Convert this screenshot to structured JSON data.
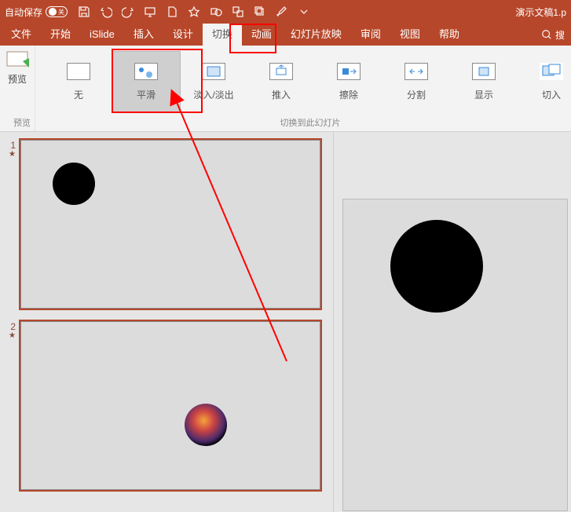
{
  "titlebar": {
    "autosave_label": "自动保存",
    "autosave_state": "关",
    "doc_name": "演示文稿1.p"
  },
  "menubar": {
    "items": [
      "文件",
      "开始",
      "iSlide",
      "插入",
      "设计",
      "切换",
      "动画",
      "幻灯片放映",
      "审阅",
      "视图",
      "帮助"
    ],
    "active_index": 5,
    "search_label": "搜"
  },
  "ribbon": {
    "preview_btn": "预览",
    "preview_group": "预览",
    "transitions": [
      "无",
      "平滑",
      "淡入/淡出",
      "推入",
      "擦除",
      "分割",
      "显示",
      "切入"
    ],
    "selected_transition_index": 1,
    "group_label": "切换到此幻灯片"
  },
  "panel": {
    "slides": [
      {
        "num": "1"
      },
      {
        "num": "2"
      }
    ]
  }
}
